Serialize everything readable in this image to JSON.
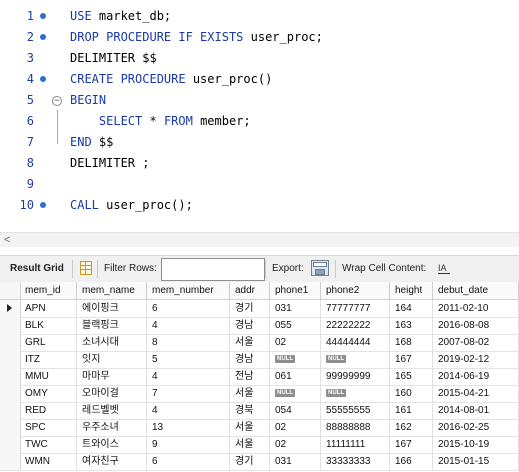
{
  "editor": {
    "lines": [
      {
        "num": "1",
        "dot": true,
        "parts": [
          {
            "t": "USE",
            "k": true
          },
          {
            "t": " market_db;",
            "k": false
          }
        ]
      },
      {
        "num": "2",
        "dot": true,
        "parts": [
          {
            "t": "DROP PROCEDURE IF EXISTS",
            "k": true
          },
          {
            "t": " user_proc;",
            "k": false
          }
        ]
      },
      {
        "num": "3",
        "dot": false,
        "parts": [
          {
            "t": "DELIMITER $$",
            "k": false
          }
        ]
      },
      {
        "num": "4",
        "dot": true,
        "parts": [
          {
            "t": "CREATE PROCEDURE",
            "k": true
          },
          {
            "t": " user_proc()",
            "k": false
          }
        ]
      },
      {
        "num": "5",
        "dot": false,
        "fold": "−",
        "parts": [
          {
            "t": "BEGIN",
            "k": true
          }
        ]
      },
      {
        "num": "6",
        "dot": false,
        "parts": [
          {
            "t": "    SELECT",
            "k": true
          },
          {
            "t": " * ",
            "k": false
          },
          {
            "t": "FROM",
            "k": true
          },
          {
            "t": " member;",
            "k": false
          }
        ]
      },
      {
        "num": "7",
        "dot": false,
        "parts": [
          {
            "t": "END",
            "k": true
          },
          {
            "t": " $$",
            "k": false
          }
        ]
      },
      {
        "num": "8",
        "dot": false,
        "parts": [
          {
            "t": "DELIMITER ;",
            "k": false
          }
        ]
      },
      {
        "num": "9",
        "dot": false,
        "parts": []
      },
      {
        "num": "10",
        "dot": true,
        "parts": [
          {
            "t": "CALL",
            "k": true
          },
          {
            "t": " user_proc();",
            "k": false
          }
        ]
      }
    ]
  },
  "scroll_arrow": "<",
  "toolbar": {
    "result_grid": "Result Grid",
    "filter_rows": "Filter Rows:",
    "filter_value": "",
    "export": "Export:",
    "wrap_cell": "Wrap Cell Content:",
    "icons": [
      "grid-icon",
      "export-icon",
      "wrap-icon"
    ]
  },
  "grid": {
    "columns": [
      "mem_id",
      "mem_name",
      "mem_number",
      "addr",
      "phone1",
      "phone2",
      "height",
      "debut_date"
    ],
    "null_label": "NULL",
    "rows": [
      [
        "APN",
        "에이핑크",
        "6",
        "경기",
        "031",
        "77777777",
        "164",
        "2011-02-10"
      ],
      [
        "BLK",
        "블랙핑크",
        "4",
        "경남",
        "055",
        "22222222",
        "163",
        "2016-08-08"
      ],
      [
        "GRL",
        "소녀시대",
        "8",
        "서울",
        "02",
        "44444444",
        "168",
        "2007-08-02"
      ],
      [
        "ITZ",
        "잇지",
        "5",
        "경남",
        null,
        null,
        "167",
        "2019-02-12"
      ],
      [
        "MMU",
        "마마무",
        "4",
        "전남",
        "061",
        "99999999",
        "165",
        "2014-06-19"
      ],
      [
        "OMY",
        "오마이걸",
        "7",
        "서울",
        null,
        null,
        "160",
        "2015-04-21"
      ],
      [
        "RED",
        "레드벨벳",
        "4",
        "경북",
        "054",
        "55555555",
        "161",
        "2014-08-01"
      ],
      [
        "SPC",
        "우주소녀",
        "13",
        "서울",
        "02",
        "88888888",
        "162",
        "2016-02-25"
      ],
      [
        "TWC",
        "트와이스",
        "9",
        "서울",
        "02",
        "11111111",
        "167",
        "2015-10-19"
      ],
      [
        "WMN",
        "여자친구",
        "6",
        "경기",
        "031",
        "33333333",
        "166",
        "2015-01-15"
      ]
    ]
  }
}
